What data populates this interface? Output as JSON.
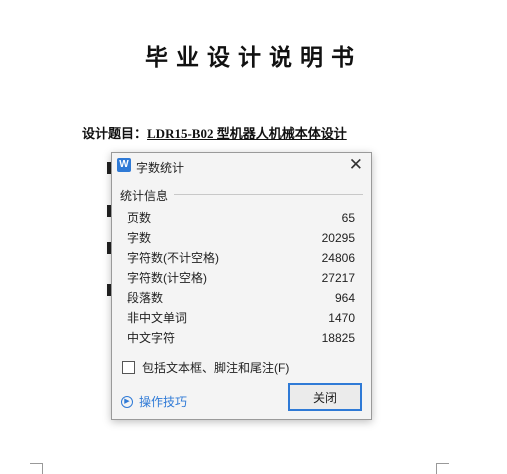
{
  "document": {
    "title": "毕业设计说明书",
    "topic_label": "设计题目：",
    "topic_value": "LDR15-B02 型机器人机械本体设计"
  },
  "dialog": {
    "title": "字数统计",
    "close_icon": "close-icon",
    "group_label": "统计信息",
    "stats": [
      {
        "label": "页数",
        "value": "65"
      },
      {
        "label": "字数",
        "value": "20295"
      },
      {
        "label": "字符数(不计空格)",
        "value": "24806"
      },
      {
        "label": "字符数(计空格)",
        "value": "27217"
      },
      {
        "label": "段落数",
        "value": "964"
      },
      {
        "label": "非中文单词",
        "value": "1470"
      },
      {
        "label": "中文字符",
        "value": "18825"
      }
    ],
    "checkbox_label": "包括文本框、脚注和尾注(F)",
    "checkbox_checked": false,
    "tips_label": "操作技巧",
    "close_button": "关闭",
    "accent_color": "#2f7ad6"
  }
}
